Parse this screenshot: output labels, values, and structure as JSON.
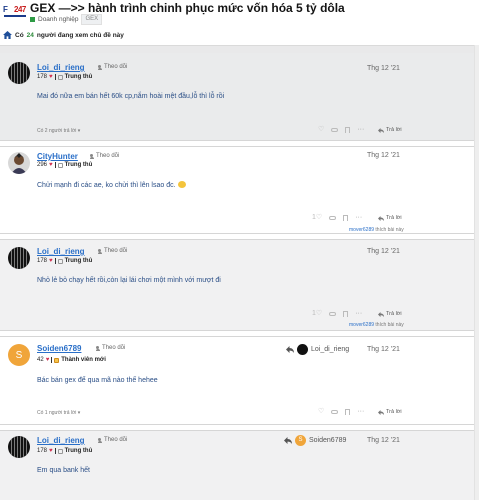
{
  "header": {
    "logo": {
      "f": "F",
      "num": "247"
    },
    "title": "GEX —>> hành trình chinh phục mức vốn hóa 5 tỷ dôla",
    "category": "Doanh nghiệp",
    "tag": "GEX"
  },
  "viewers": {
    "prefix": "Có",
    "count": "24",
    "suffix": "người đang xem chủ đề này"
  },
  "posts": [
    {
      "username": "Loi_di_rieng",
      "follow": "Theo dõi",
      "points": "178",
      "rank": "Trung thủ",
      "date": "Thg 12 '21",
      "content": "Mai đó nữa em bán hết 60k cp,nắm hoài mệt đầu,lỗ thì lỗ rồi",
      "footer_left": "Có 2 người trả lời",
      "reply": "Trả lời"
    },
    {
      "username": "CityHunter",
      "follow": "Theo dõi",
      "points": "296",
      "rank": "Trung thủ",
      "date": "Thg 12 '21",
      "content": "Chửi mạnh đi các ae, ko chửi thì lên lsao đc.",
      "like_count": "1",
      "reply": "Trả lời",
      "liker": "mover6289",
      "liker_suffix": "thích bài này"
    },
    {
      "username": "Loi_di_rieng",
      "follow": "Theo dõi",
      "points": "178",
      "rank": "Trung thủ",
      "date": "Thg 12 '21",
      "content": "Nhỏ lẻ bỏ chạy hết rồi,còn lại lái chơi một mình với mượt đi",
      "like_count": "1",
      "reply": "Trả lời",
      "liker": "mover6289",
      "liker_suffix": "thích bài này"
    },
    {
      "username": "Soiden6789",
      "avatar_letter": "S",
      "follow": "Theo dõi",
      "points": "42",
      "rank": "Thành viên mới",
      "quote_user": "Loi_di_rieng",
      "date": "Thg 12 '21",
      "content": "Bác bán gex để qua mã nào thế hehee",
      "footer_left": "Có 1 người trả lời",
      "reply": "Trả lời"
    },
    {
      "username": "Loi_di_rieng",
      "follow": "Theo dõi",
      "points": "178",
      "rank": "Trung thủ",
      "quote_user": "Soiden6789",
      "quote_letter": "S",
      "date": "Thg 12 '21",
      "content": "Em qua bank hết"
    }
  ],
  "colors": {
    "link": "#2a6fc8",
    "heart": "#d32f4f",
    "green": "#2c8a3a"
  },
  "icons": [
    "home-icon",
    "follow-icon",
    "heart-icon",
    "link-icon",
    "bookmark-icon",
    "more-icon",
    "reply-icon"
  ]
}
